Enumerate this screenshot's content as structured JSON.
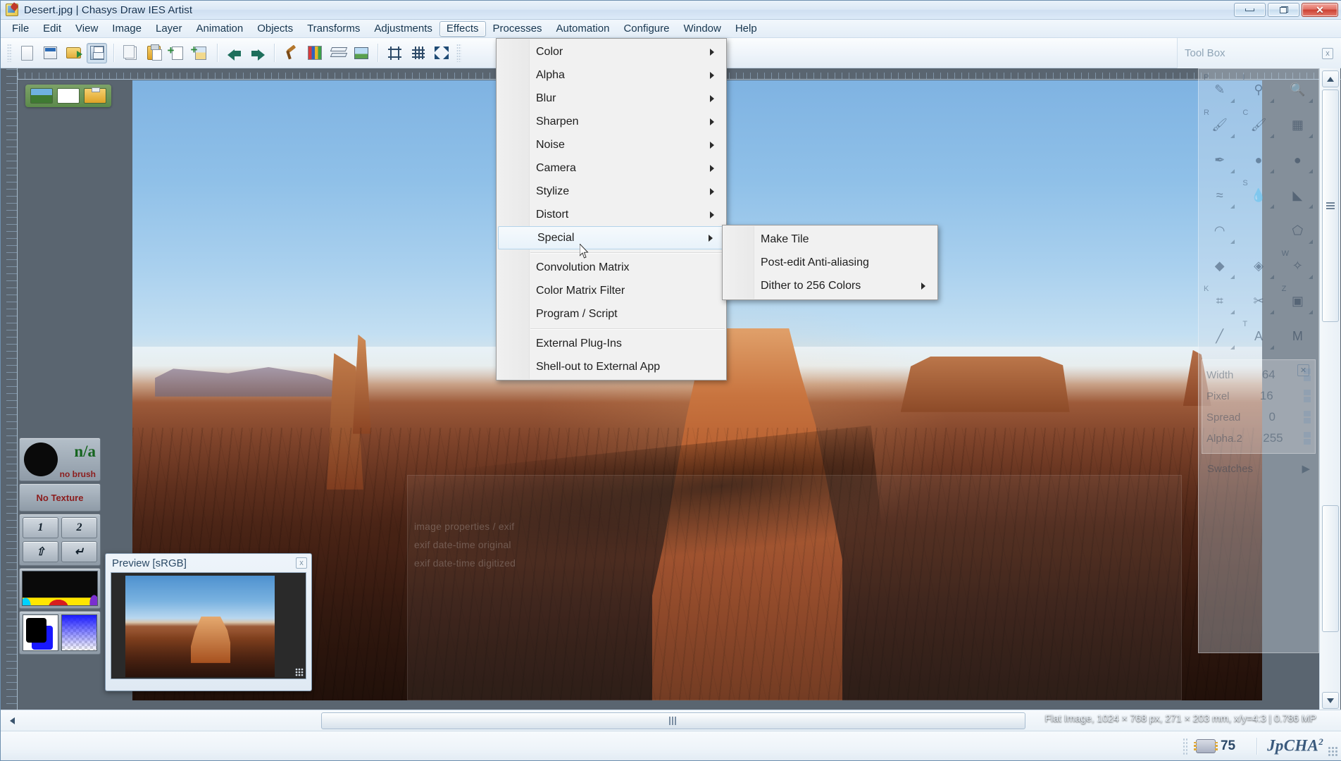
{
  "window": {
    "title": "Desert.jpg | Chasys Draw IES Artist",
    "app_icon": "artist-app-icon",
    "buttons": {
      "minimize": "minimize",
      "restore": "restore",
      "close": "close"
    }
  },
  "menubar": {
    "items": [
      {
        "label": "File",
        "active": false
      },
      {
        "label": "Edit",
        "active": false
      },
      {
        "label": "View",
        "active": false
      },
      {
        "label": "Image",
        "active": false
      },
      {
        "label": "Layer",
        "active": false
      },
      {
        "label": "Animation",
        "active": false
      },
      {
        "label": "Objects",
        "active": false
      },
      {
        "label": "Transforms",
        "active": false
      },
      {
        "label": "Adjustments",
        "active": false
      },
      {
        "label": "Effects",
        "active": true
      },
      {
        "label": "Processes",
        "active": false
      },
      {
        "label": "Automation",
        "active": false
      },
      {
        "label": "Configure",
        "active": false
      },
      {
        "label": "Window",
        "active": false
      },
      {
        "label": "Help",
        "active": false
      }
    ]
  },
  "toolbar": {
    "buttons": [
      {
        "name": "new-file-icon",
        "pressed": false
      },
      {
        "name": "open-document-icon",
        "pressed": false
      },
      {
        "name": "open-folder-icon",
        "pressed": false
      },
      {
        "name": "save-icon",
        "pressed": true
      },
      {
        "name": "copy-icon",
        "pressed": false
      },
      {
        "name": "paste-icon",
        "pressed": false
      },
      {
        "name": "new-layer-icon",
        "pressed": false
      },
      {
        "name": "new-image-layer-icon",
        "pressed": false
      },
      {
        "name": "undo-icon",
        "pressed": false
      },
      {
        "name": "redo-icon",
        "pressed": false
      },
      {
        "name": "tools-icon",
        "pressed": false
      },
      {
        "name": "palette-icon",
        "pressed": false
      },
      {
        "name": "layers-icon",
        "pressed": false
      },
      {
        "name": "image-icon",
        "pressed": false
      },
      {
        "name": "crop-marks-icon",
        "pressed": false
      },
      {
        "name": "grid-icon",
        "pressed": false
      },
      {
        "name": "fit-to-screen-icon",
        "pressed": false
      }
    ]
  },
  "effects_menu": {
    "open": true,
    "items": [
      {
        "label": "Color",
        "submenu": true,
        "highlighted": false,
        "separator_after": false
      },
      {
        "label": "Alpha",
        "submenu": true,
        "highlighted": false,
        "separator_after": false
      },
      {
        "label": "Blur",
        "submenu": true,
        "highlighted": false,
        "separator_after": false
      },
      {
        "label": "Sharpen",
        "submenu": true,
        "highlighted": false,
        "separator_after": false
      },
      {
        "label": "Noise",
        "submenu": true,
        "highlighted": false,
        "separator_after": false
      },
      {
        "label": "Camera",
        "submenu": true,
        "highlighted": false,
        "separator_after": false
      },
      {
        "label": "Stylize",
        "submenu": true,
        "highlighted": false,
        "separator_after": false
      },
      {
        "label": "Distort",
        "submenu": true,
        "highlighted": false,
        "separator_after": false
      },
      {
        "label": "Special",
        "submenu": true,
        "highlighted": true,
        "separator_after": true
      },
      {
        "label": "Convolution Matrix",
        "submenu": false,
        "highlighted": false,
        "separator_after": false
      },
      {
        "label": "Color Matrix Filter",
        "submenu": false,
        "highlighted": false,
        "separator_after": false
      },
      {
        "label": "Program / Script",
        "submenu": false,
        "highlighted": false,
        "separator_after": true
      },
      {
        "label": "External Plug-Ins",
        "submenu": false,
        "highlighted": false,
        "separator_after": false
      },
      {
        "label": "Shell-out to External App",
        "submenu": false,
        "highlighted": false,
        "separator_after": false
      }
    ]
  },
  "special_submenu": {
    "open": true,
    "items": [
      {
        "label": "Make Tile",
        "submenu": false
      },
      {
        "label": "Post-edit Anti-aliasing",
        "submenu": false
      },
      {
        "label": "Dither to 256 Colors",
        "submenu": true
      }
    ]
  },
  "toolbox_panel": {
    "title": "Tool Box",
    "close_label": "x",
    "tools": [
      {
        "key": "P",
        "icon": "pencil-icon"
      },
      {
        "key": "I",
        "icon": "eyedropper-icon"
      },
      {
        "key": "",
        "icon": "magnifier-icon"
      },
      {
        "key": "R",
        "icon": "effect-brush-icon"
      },
      {
        "key": "C",
        "icon": "clone-brush-icon"
      },
      {
        "key": "",
        "icon": "pattern-brush-icon"
      },
      {
        "key": "",
        "icon": "airbrush-icon"
      },
      {
        "key": "",
        "icon": "sphere-shade-icon"
      },
      {
        "key": "",
        "icon": "sphere-light-icon"
      },
      {
        "key": "",
        "icon": "smudge-icon"
      },
      {
        "key": "S",
        "icon": "water-drop-icon"
      },
      {
        "key": "",
        "icon": "gradient-icon"
      },
      {
        "key": "",
        "icon": "arc-icon"
      },
      {
        "key": "",
        "icon": "polygon-icon"
      },
      {
        "key": "",
        "icon": "fill-bucket-icon"
      },
      {
        "key": "",
        "icon": "gradient-fill-icon"
      },
      {
        "key": "W",
        "icon": "wand-icon"
      },
      {
        "key": "K",
        "icon": "crop-icon"
      },
      {
        "key": "",
        "icon": "knife-icon"
      },
      {
        "key": "Z",
        "icon": "select-region-icon"
      },
      {
        "key": "",
        "icon": "paint-line-icon"
      },
      {
        "key": "T",
        "icon": "text-tool-icon"
      }
    ],
    "color_fields": [
      {
        "label": "Width",
        "value": "64"
      },
      {
        "label": "Pixel",
        "value": "16"
      },
      {
        "label": "Spread",
        "value": "0"
      },
      {
        "label": "Alpha.2",
        "value": "255"
      }
    ],
    "swatches_label": "Swatches",
    "mode_letter": "M"
  },
  "left_panels": {
    "brush": {
      "na_label": "n/a",
      "caption": "no brush"
    },
    "texture": {
      "label": "No Texture"
    },
    "pads": [
      {
        "label": "1",
        "name": "pad-1"
      },
      {
        "label": "2",
        "name": "pad-2"
      },
      {
        "label": "⇧",
        "name": "pad-shift"
      },
      {
        "label": "↵",
        "name": "pad-enter"
      }
    ],
    "histogram_name": "histogram-thumbnail",
    "colors_name": "foreground-background-colors"
  },
  "layer_chips": [
    {
      "name": "layer-chip-photo"
    },
    {
      "name": "layer-chip-blank"
    },
    {
      "name": "layer-chip-clipboard"
    }
  ],
  "preview_window": {
    "title": "Preview [sRGB]",
    "close_label": "x",
    "image_name": "desert-preview-thumbnail"
  },
  "canvas": {
    "image_name": "desert-photo",
    "metadata_ghost_lines": [
      "image properties / exif",
      "exif date-time original",
      "exif date-time digitized"
    ]
  },
  "image_info": {
    "text": "Flat Image, 1024 × 768 px, 271 × 203 mm, x/y=4:3 | 0.786 MP"
  },
  "statusbar": {
    "cpu_value": "75",
    "brand": "JpCHA",
    "brand_sup": "2"
  },
  "colors": {
    "titlebar_text": "#12304f",
    "menu_highlight_border": "#b3d3ea",
    "accent_green": "#16651f",
    "accent_red": "#8c1d1d",
    "close_button": "#cc4133",
    "workspace_bg": "#5a6570"
  }
}
